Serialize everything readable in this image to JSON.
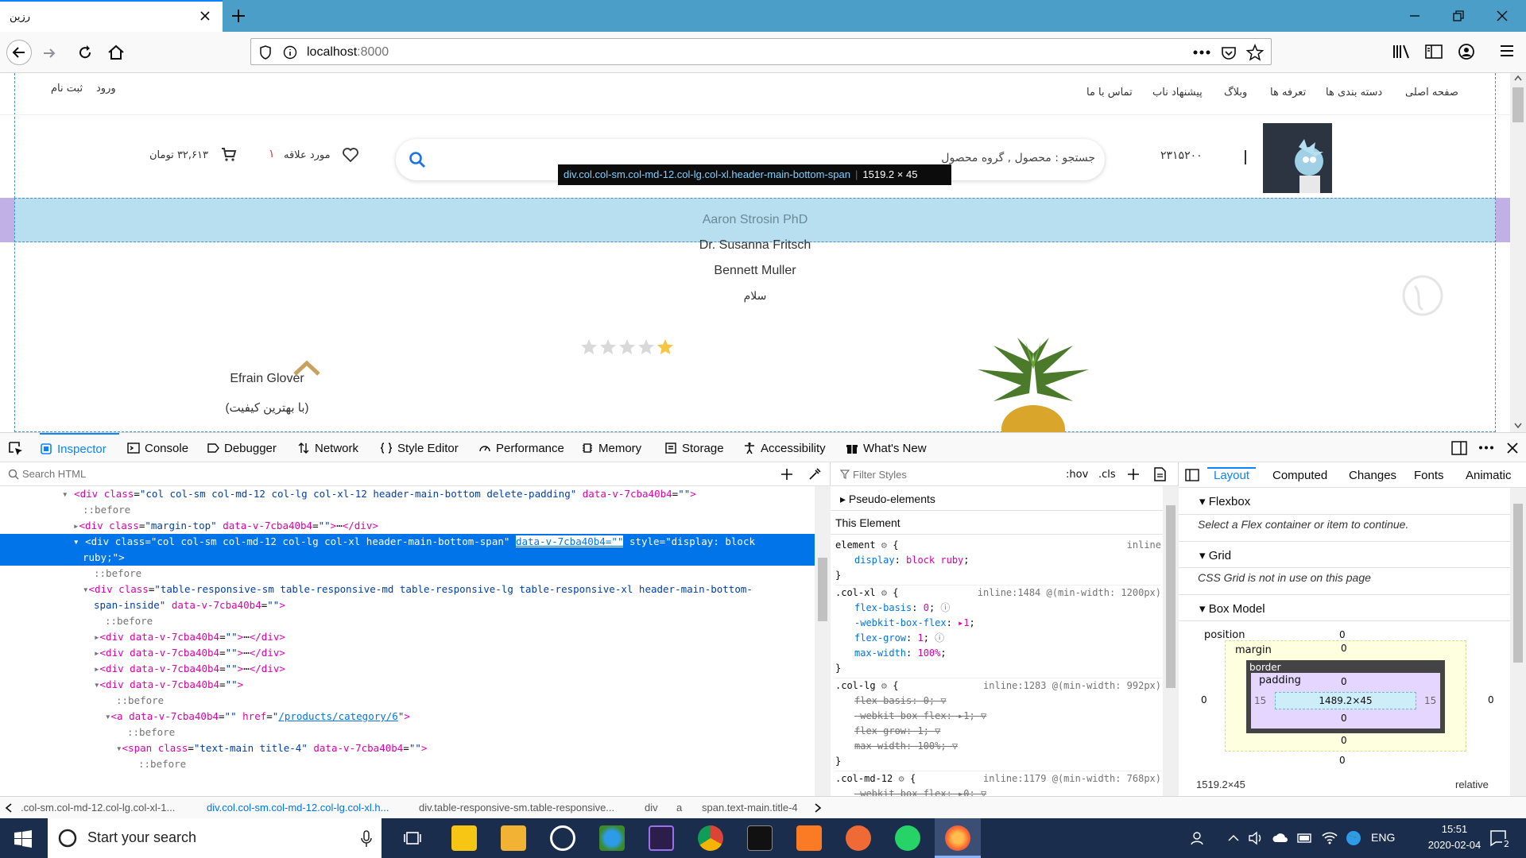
{
  "browser": {
    "tab_title": "رزین",
    "url_host": "localhost",
    "url_port": ":8000"
  },
  "site": {
    "nav": [
      "صفحه اصلی",
      "دسته بندی ها",
      "تعرفه ها",
      "وبلاگ",
      "پیشنهاد ناب",
      "تماس با ما"
    ],
    "login": "ورود",
    "register": "ثبت نام",
    "phone": "۲۳۱۵۲۰۰",
    "search_placeholder": "جستجو : محصول , گروه محصول",
    "wishlist_label": "مورد علاقه",
    "wishlist_count": "۱",
    "cart_total": "۳۲,۶۱۳ تومان",
    "menu_items": [
      "Aaron Strosin PhD",
      "Dr. Susanna Fritsch",
      "Bennett Muller",
      "سلام"
    ],
    "product_name": "Efrain Glover",
    "product_tag": "(با بهترین کیفیت)",
    "rating": 1
  },
  "tooltip": {
    "selector": "div.col.col-sm.col-md-12.col-lg.col-xl.header-main-bottom-span",
    "size": "1519.2 × 45"
  },
  "devtools": {
    "tabs": [
      "Inspector",
      "Console",
      "Debugger",
      "Network",
      "Style Editor",
      "Performance",
      "Memory",
      "Storage",
      "Accessibility",
      "What's New"
    ],
    "search_html": "Search HTML",
    "filter_styles": "Filter Styles",
    "hov": ":hov",
    "cls": ".cls",
    "side_tabs": [
      "Layout",
      "Computed",
      "Changes",
      "Fonts",
      "Animatic"
    ],
    "pseudo": "Pseudo-elements",
    "this_element": "This Element",
    "flexbox": "Flexbox",
    "flexbox_msg": "Select a Flex container or item to continue.",
    "grid": "Grid",
    "grid_msg": "CSS Grid is not in use on this page",
    "boxmodel": "Box Model",
    "bm": {
      "position": "position",
      "margin": "margin",
      "border": "border",
      "padding": "padding",
      "content": "1489.2×45",
      "pad_lr": "15",
      "zero": "0",
      "size": "1519.2×45",
      "pos_val": "relative"
    },
    "crumbs": [
      ".col-sm.col-md-12.col-lg.col-xl-1...",
      "div.col.col-sm.col-md-12.col-lg.col-xl.h...",
      "div.table-responsive-sm.table-responsive...",
      "div",
      "a",
      "span.text-main.title-4"
    ]
  },
  "taskbar": {
    "search": "Start your search",
    "lang": "ENG",
    "time": "15:51",
    "date": "2020-02-04",
    "notif": "2"
  }
}
